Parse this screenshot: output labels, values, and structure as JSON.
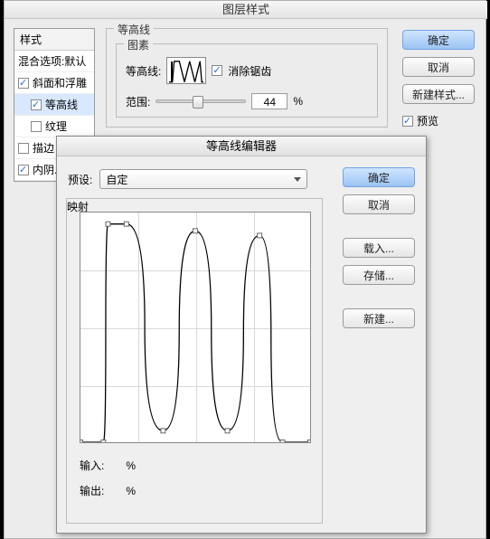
{
  "main": {
    "title": "图层样式",
    "styles_header": "样式",
    "blend_row": "混合选项:默认",
    "styles": [
      {
        "label": "斜面和浮雕",
        "checked": true,
        "indent": 0,
        "selected": false
      },
      {
        "label": "等高线",
        "checked": true,
        "indent": 1,
        "selected": true
      },
      {
        "label": "纹理",
        "checked": false,
        "indent": 1,
        "selected": false
      },
      {
        "label": "描边",
        "checked": false,
        "indent": 0,
        "selected": false
      },
      {
        "label": "内阴...",
        "checked": true,
        "indent": 0,
        "selected": false
      }
    ],
    "contour_group": "等高线",
    "pixel_group": "图素",
    "contour_label": "等高线:",
    "antialias_label": "消除锯齿",
    "antialias_checked": true,
    "range_label": "范围:",
    "range_value": "44",
    "percent": "%",
    "buttons": {
      "ok": "确定",
      "cancel": "取消",
      "new_style": "新建样式...",
      "preview": "预览",
      "preview_checked": true
    }
  },
  "editor": {
    "title": "等高线编辑器",
    "preset_label": "预设:",
    "preset_value": "自定",
    "map_label": "映射",
    "buttons": {
      "ok": "确定",
      "cancel": "取消",
      "load": "载入...",
      "save": "存储...",
      "new": "新建..."
    },
    "input_label": "输入:",
    "output_label": "输出:",
    "percent": "%"
  },
  "chart_data": {
    "type": "line",
    "title": "映射",
    "xlabel": "输入",
    "ylabel": "输出",
    "xlim": [
      0,
      100
    ],
    "ylim": [
      0,
      100
    ],
    "points": [
      {
        "x": 0,
        "y": 0
      },
      {
        "x": 10,
        "y": 0
      },
      {
        "x": 12,
        "y": 95
      },
      {
        "x": 20,
        "y": 95
      },
      {
        "x": 36,
        "y": 5
      },
      {
        "x": 50,
        "y": 92
      },
      {
        "x": 64,
        "y": 5
      },
      {
        "x": 78,
        "y": 90
      },
      {
        "x": 88,
        "y": 0
      },
      {
        "x": 100,
        "y": 0
      }
    ]
  }
}
